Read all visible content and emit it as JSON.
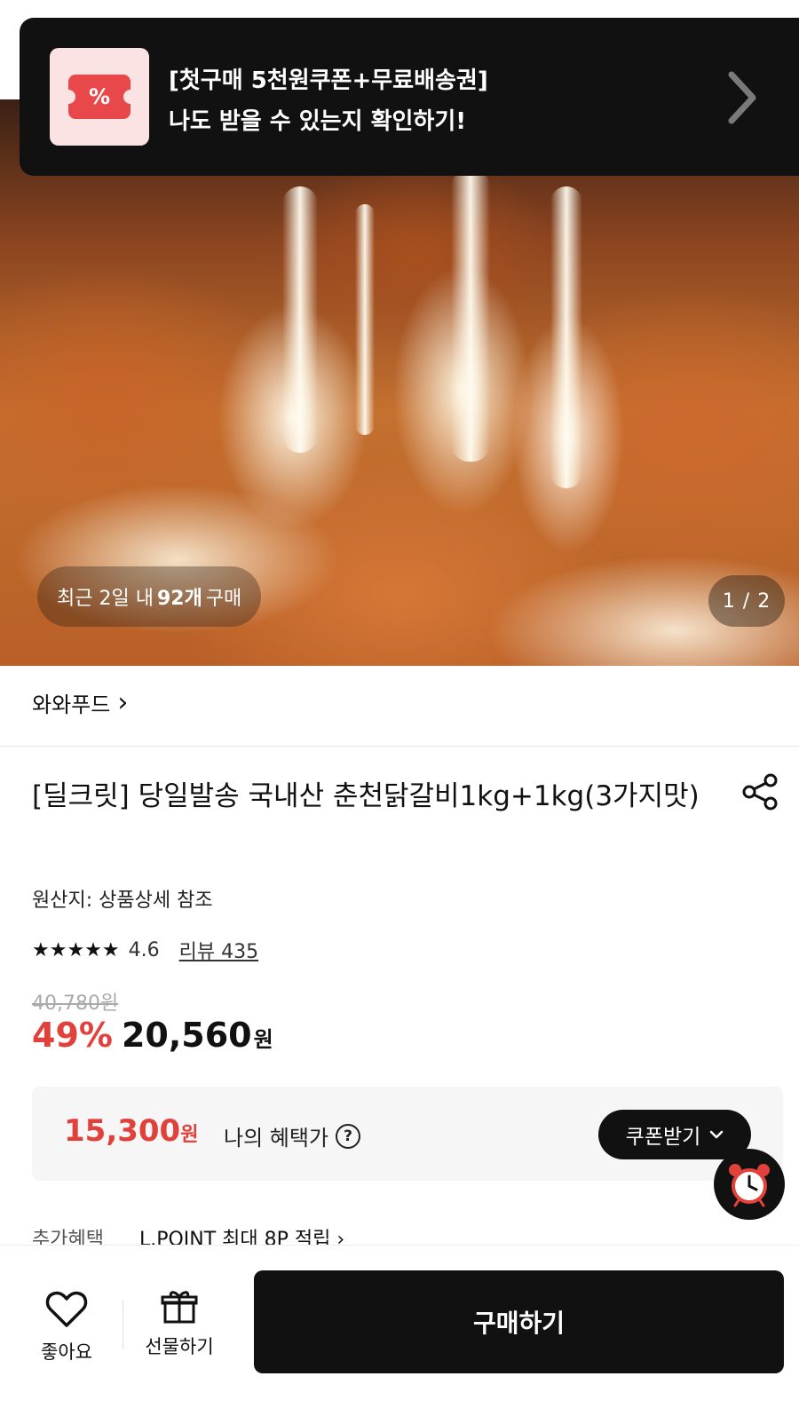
{
  "coupon_banner": {
    "icon": "percent-ticket-icon",
    "line1": "[첫구매 5천원쿠폰+무료배송권]",
    "line2": "나도 받을 수 있는지 확인하기!",
    "icon_text": "%"
  },
  "hero": {
    "recent_prefix": "최근 2일 내",
    "recent_count": "92개",
    "recent_suffix": "구매",
    "page_counter": "1 / 2"
  },
  "seller": {
    "name": "와와푸드",
    "chevron": "›"
  },
  "product": {
    "title": "[딜크릿] 당일발송 국내산 춘천닭갈비1kg+1kg(3가지맛)",
    "origin": "원산지: 상품상세 참조",
    "rating": 4.6,
    "rating_text": "4.6",
    "stars": "★★★★★",
    "review_link": "리뷰 435",
    "original_price": "40,780원",
    "discount": "49%",
    "price": "20,560",
    "price_unit": "원"
  },
  "benefit": {
    "price": "15,300",
    "price_unit": "원",
    "label": "나의 혜택가",
    "help": "?",
    "coupon_button": "쿠폰받기"
  },
  "extra": {
    "label": "추가혜택",
    "value": "L.POINT 최대 8P 적립 ›"
  },
  "bottom_bar": {
    "like_label": "좋아요",
    "gift_label": "선물하기",
    "buy_label": "구매하기"
  },
  "colors": {
    "accent_red": "#e2413b",
    "dark": "#111111",
    "ticket_red": "#e8484a",
    "ticket_bg": "#fbe3e3"
  }
}
